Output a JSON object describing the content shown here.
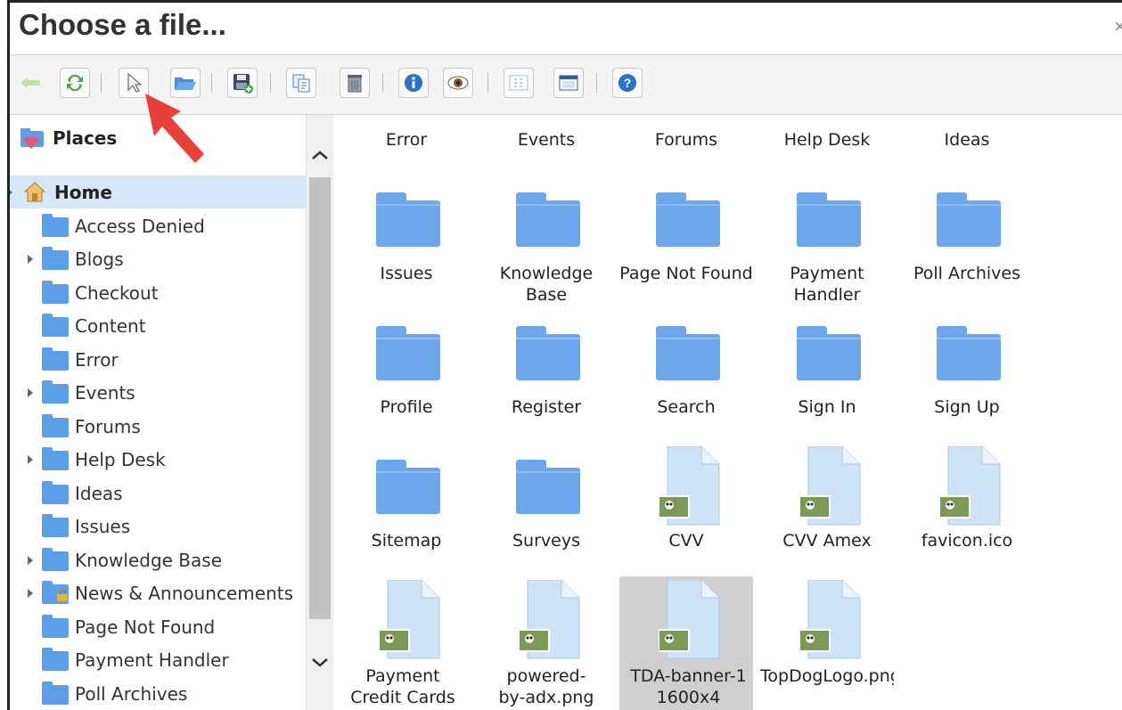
{
  "window": {
    "title": "Choose a file...",
    "close_glyph": "×"
  },
  "toolbar": {
    "buttons": [
      {
        "name": "back-arrow-icon"
      },
      {
        "name": "refresh-icon"
      },
      {
        "name": "select-cursor-icon"
      },
      {
        "name": "open-folder-icon"
      },
      {
        "name": "save-icon"
      },
      {
        "name": "copy-icon"
      },
      {
        "name": "delete-icon"
      },
      {
        "name": "info-icon"
      },
      {
        "name": "preview-eye-icon"
      },
      {
        "name": "grid-view-icon"
      },
      {
        "name": "details-view-icon"
      },
      {
        "name": "help-icon"
      }
    ]
  },
  "sidebar": {
    "places_label": "Places",
    "items": [
      {
        "label": "Home",
        "expandable": true,
        "selected": true
      },
      {
        "label": "Access Denied"
      },
      {
        "label": "Blogs",
        "expandable": true
      },
      {
        "label": "Checkout"
      },
      {
        "label": "Content"
      },
      {
        "label": "Error"
      },
      {
        "label": "Events",
        "expandable": true
      },
      {
        "label": "Forums"
      },
      {
        "label": "Help Desk",
        "expandable": true
      },
      {
        "label": "Ideas"
      },
      {
        "label": "Issues"
      },
      {
        "label": "Knowledge Base",
        "expandable": true
      },
      {
        "label": "News & Announcements",
        "expandable": true,
        "locked": true
      },
      {
        "label": "Page Not Found"
      },
      {
        "label": "Payment Handler"
      },
      {
        "label": "Poll Archives"
      }
    ]
  },
  "content": {
    "row0": [
      "Error",
      "Events",
      "Forums",
      "Help Desk",
      "Ideas"
    ],
    "row1": [
      "Issues",
      "Knowledge Base",
      "Page Not Found",
      "Payment Handler",
      "Poll Archives"
    ],
    "row2": [
      "Profile",
      "Register",
      "Search",
      "Sign In",
      "Sign Up"
    ],
    "row3": [
      "Sitemap",
      "Surveys",
      "CVV",
      "CVV Amex",
      "favicon.ico"
    ],
    "row4": [
      "Payment Credit Cards Ac...ted",
      "powered-by-adx.png",
      "TDA-banner-1 1600x4",
      "TopDogLogo.png"
    ]
  },
  "colors": {
    "folder": "#6ea6ec",
    "selection": "#d3e7f9",
    "annotation_arrow": "#e8413a"
  }
}
